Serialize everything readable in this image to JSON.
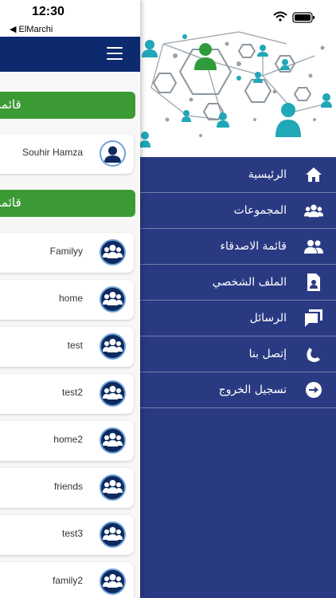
{
  "status_bar": {
    "time": "12:30",
    "back_app": "◀ ElMarchi"
  },
  "drawer": {
    "menu": [
      {
        "label": "الرئيسية",
        "icon": "home-icon"
      },
      {
        "label": "المجموعات",
        "icon": "groups-icon"
      },
      {
        "label": "قائمة الاصدقاء",
        "icon": "friends-icon"
      },
      {
        "label": "الملف الشخصي",
        "icon": "profile-icon"
      },
      {
        "label": "الرسائل",
        "icon": "messages-icon"
      },
      {
        "label": "إتصل بنا",
        "icon": "phone-icon"
      },
      {
        "label": "تسجيل الخروج",
        "icon": "logout-icon"
      }
    ]
  },
  "main": {
    "section1": {
      "title": "قائمة"
    },
    "friend": {
      "name": "Souhir  Hamza"
    },
    "section2": {
      "title": "قائمة"
    },
    "groups": [
      {
        "name": "Familyy"
      },
      {
        "name": "home"
      },
      {
        "name": "test"
      },
      {
        "name": "test2"
      },
      {
        "name": "home2"
      },
      {
        "name": "friends"
      },
      {
        "name": "test3"
      },
      {
        "name": "family2"
      }
    ]
  },
  "colors": {
    "drawer_bg": "#2a3a82",
    "navbar": "#0e2a6e",
    "section_green": "#3c9a35",
    "accent_teal": "#20a7b8"
  }
}
